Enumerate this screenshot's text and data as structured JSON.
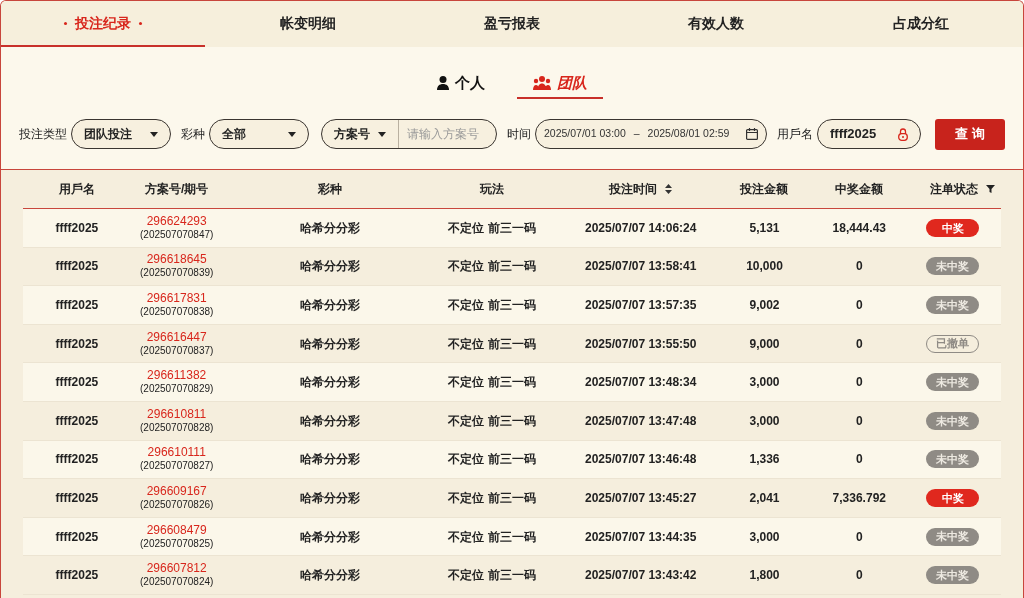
{
  "tabs": [
    {
      "label": "投注纪录",
      "selected": true
    },
    {
      "label": "帐变明细",
      "selected": false
    },
    {
      "label": "盈亏报表",
      "selected": false
    },
    {
      "label": "有效人数",
      "selected": false
    },
    {
      "label": "占成分红",
      "selected": false
    }
  ],
  "scope_tabs": [
    {
      "label": "个人",
      "kind": "person",
      "selected": false
    },
    {
      "label": "团队",
      "kind": "group",
      "selected": true
    }
  ],
  "filters": {
    "bet_type_label": "投注类型",
    "bet_type": "团队投注",
    "lottery_label": "彩种",
    "lottery": "全部",
    "plan_select": "方案号",
    "plan_placeholder": "请输入方案号",
    "time_label": "时间",
    "time_start": "2025/07/01 03:00",
    "time_sep": "–",
    "time_end": "2025/08/01 02:59",
    "user_label": "用戶名",
    "user": "ffff2025",
    "query_button": "查 询"
  },
  "table": {
    "columns": [
      {
        "label": "用戶名"
      },
      {
        "label": "方案号/期号"
      },
      {
        "label": "彩种"
      },
      {
        "label": "玩法"
      },
      {
        "label": "投注时间",
        "sortable": true
      },
      {
        "label": "投注金额"
      },
      {
        "label": "中奖金额"
      },
      {
        "label": "注单状态",
        "filterable": true
      }
    ],
    "rows": [
      {
        "user": "ffff2025",
        "plan": "296624293",
        "issue": "(202507070847)",
        "lottery": "哈希分分彩",
        "play": "不定位 前三一码",
        "time": "2025/07/07 14:06:24",
        "amount": "5,131",
        "prize": "18,444.43",
        "status": {
          "label": "中奖",
          "kind": "won"
        }
      },
      {
        "user": "ffff2025",
        "plan": "296618645",
        "issue": "(202507070839)",
        "lottery": "哈希分分彩",
        "play": "不定位 前三一码",
        "time": "2025/07/07 13:58:41",
        "amount": "10,000",
        "prize": "0",
        "status": {
          "label": "未中奖",
          "kind": "lost"
        }
      },
      {
        "user": "ffff2025",
        "plan": "296617831",
        "issue": "(202507070838)",
        "lottery": "哈希分分彩",
        "play": "不定位 前三一码",
        "time": "2025/07/07 13:57:35",
        "amount": "9,002",
        "prize": "0",
        "status": {
          "label": "未中奖",
          "kind": "lost"
        }
      },
      {
        "user": "ffff2025",
        "plan": "296616447",
        "issue": "(202507070837)",
        "lottery": "哈希分分彩",
        "play": "不定位 前三一码",
        "time": "2025/07/07 13:55:50",
        "amount": "9,000",
        "prize": "0",
        "status": {
          "label": "已撤单",
          "kind": "cancelled"
        }
      },
      {
        "user": "ffff2025",
        "plan": "296611382",
        "issue": "(202507070829)",
        "lottery": "哈希分分彩",
        "play": "不定位 前三一码",
        "time": "2025/07/07 13:48:34",
        "amount": "3,000",
        "prize": "0",
        "status": {
          "label": "未中奖",
          "kind": "lost"
        }
      },
      {
        "user": "ffff2025",
        "plan": "296610811",
        "issue": "(202507070828)",
        "lottery": "哈希分分彩",
        "play": "不定位 前三一码",
        "time": "2025/07/07 13:47:48",
        "amount": "3,000",
        "prize": "0",
        "status": {
          "label": "未中奖",
          "kind": "lost"
        }
      },
      {
        "user": "ffff2025",
        "plan": "296610111",
        "issue": "(202507070827)",
        "lottery": "哈希分分彩",
        "play": "不定位 前三一码",
        "time": "2025/07/07 13:46:48",
        "amount": "1,336",
        "prize": "0",
        "status": {
          "label": "未中奖",
          "kind": "lost"
        }
      },
      {
        "user": "ffff2025",
        "plan": "296609167",
        "issue": "(202507070826)",
        "lottery": "哈希分分彩",
        "play": "不定位 前三一码",
        "time": "2025/07/07 13:45:27",
        "amount": "2,041",
        "prize": "7,336.792",
        "status": {
          "label": "中奖",
          "kind": "won"
        }
      },
      {
        "user": "ffff2025",
        "plan": "296608479",
        "issue": "(202507070825)",
        "lottery": "哈希分分彩",
        "play": "不定位 前三一码",
        "time": "2025/07/07 13:44:35",
        "amount": "3,000",
        "prize": "0",
        "status": {
          "label": "未中奖",
          "kind": "lost"
        }
      },
      {
        "user": "ffff2025",
        "plan": "296607812",
        "issue": "(202507070824)",
        "lottery": "哈希分分彩",
        "play": "不定位 前三一码",
        "time": "2025/07/07 13:43:42",
        "amount": "1,800",
        "prize": "0",
        "status": {
          "label": "未中奖",
          "kind": "lost"
        }
      }
    ]
  }
}
